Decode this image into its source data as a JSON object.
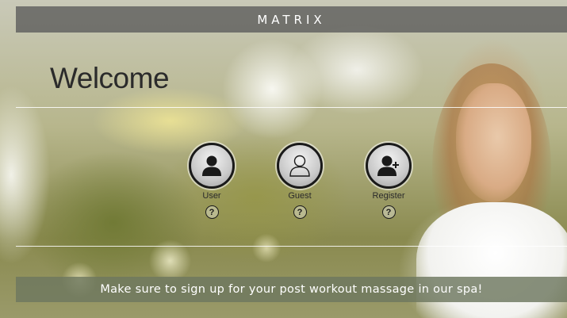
{
  "header": {
    "brand": "MATRIX"
  },
  "welcome": {
    "title": "Welcome"
  },
  "login_options": [
    {
      "label": "User",
      "icon": "user-solid-icon",
      "help": "?"
    },
    {
      "label": "Guest",
      "icon": "user-outline-icon",
      "help": "?"
    },
    {
      "label": "Register",
      "icon": "user-add-icon",
      "help": "?"
    }
  ],
  "banner": {
    "message": "Make sure to sign up for your post workout massage in our spa!"
  },
  "colors": {
    "top_bar": "#5a5a5a",
    "banner": "#6e785f",
    "icon_dark": "#1a1a1a",
    "avatar_bg": "#c9c9c9"
  }
}
